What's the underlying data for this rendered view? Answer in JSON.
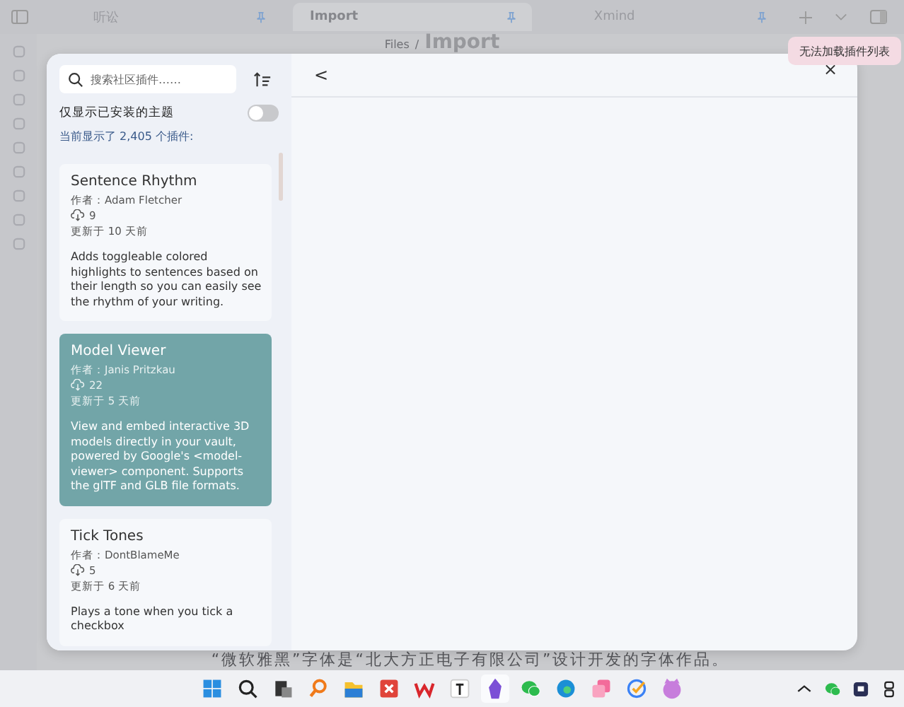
{
  "background_app": {
    "tabs": [
      {
        "label": "听讼",
        "selected": false
      },
      {
        "label": "Import",
        "selected": true
      },
      {
        "label": "Xmind",
        "selected": false
      }
    ],
    "breadcrumb": {
      "folder": "Files",
      "separator": "/",
      "title": "Import"
    },
    "body_text": "“微软雅黑”字体是“北大方正电子有限公司”设计开发的字体作品。"
  },
  "modal": {
    "search": {
      "placeholder": "搜索社区插件……"
    },
    "installed_only": {
      "label": "仅显示已安装的主题",
      "on": false
    },
    "count_text": "当前显示了 2,405 个插件:",
    "plugins": [
      {
        "name": "Sentence Rhythm",
        "author": "作者：Adam Fletcher",
        "downloads": "9",
        "updated": "更新于 10 天前",
        "description": "Adds toggleable colored highlights to sentences based on their length so you can easily see the rhythm of your writing.",
        "selected": false
      },
      {
        "name": "Model Viewer",
        "author": "作者：Janis Pritzkau",
        "downloads": "22",
        "updated": "更新于 5 天前",
        "description": "View and embed interactive 3D models directly in your vault, powered by Google's <model-viewer> component. Supports the glTF and GLB file formats.",
        "selected": true
      },
      {
        "name": "Tick Tones",
        "author": "作者：DontBlameMe",
        "downloads": "5",
        "updated": "更新于 6 天前",
        "description": "Plays a tone when you tick a checkbox",
        "selected": false
      }
    ],
    "back_button": "<",
    "close_button": "×"
  },
  "toast": {
    "message": "无法加载插件列表"
  }
}
